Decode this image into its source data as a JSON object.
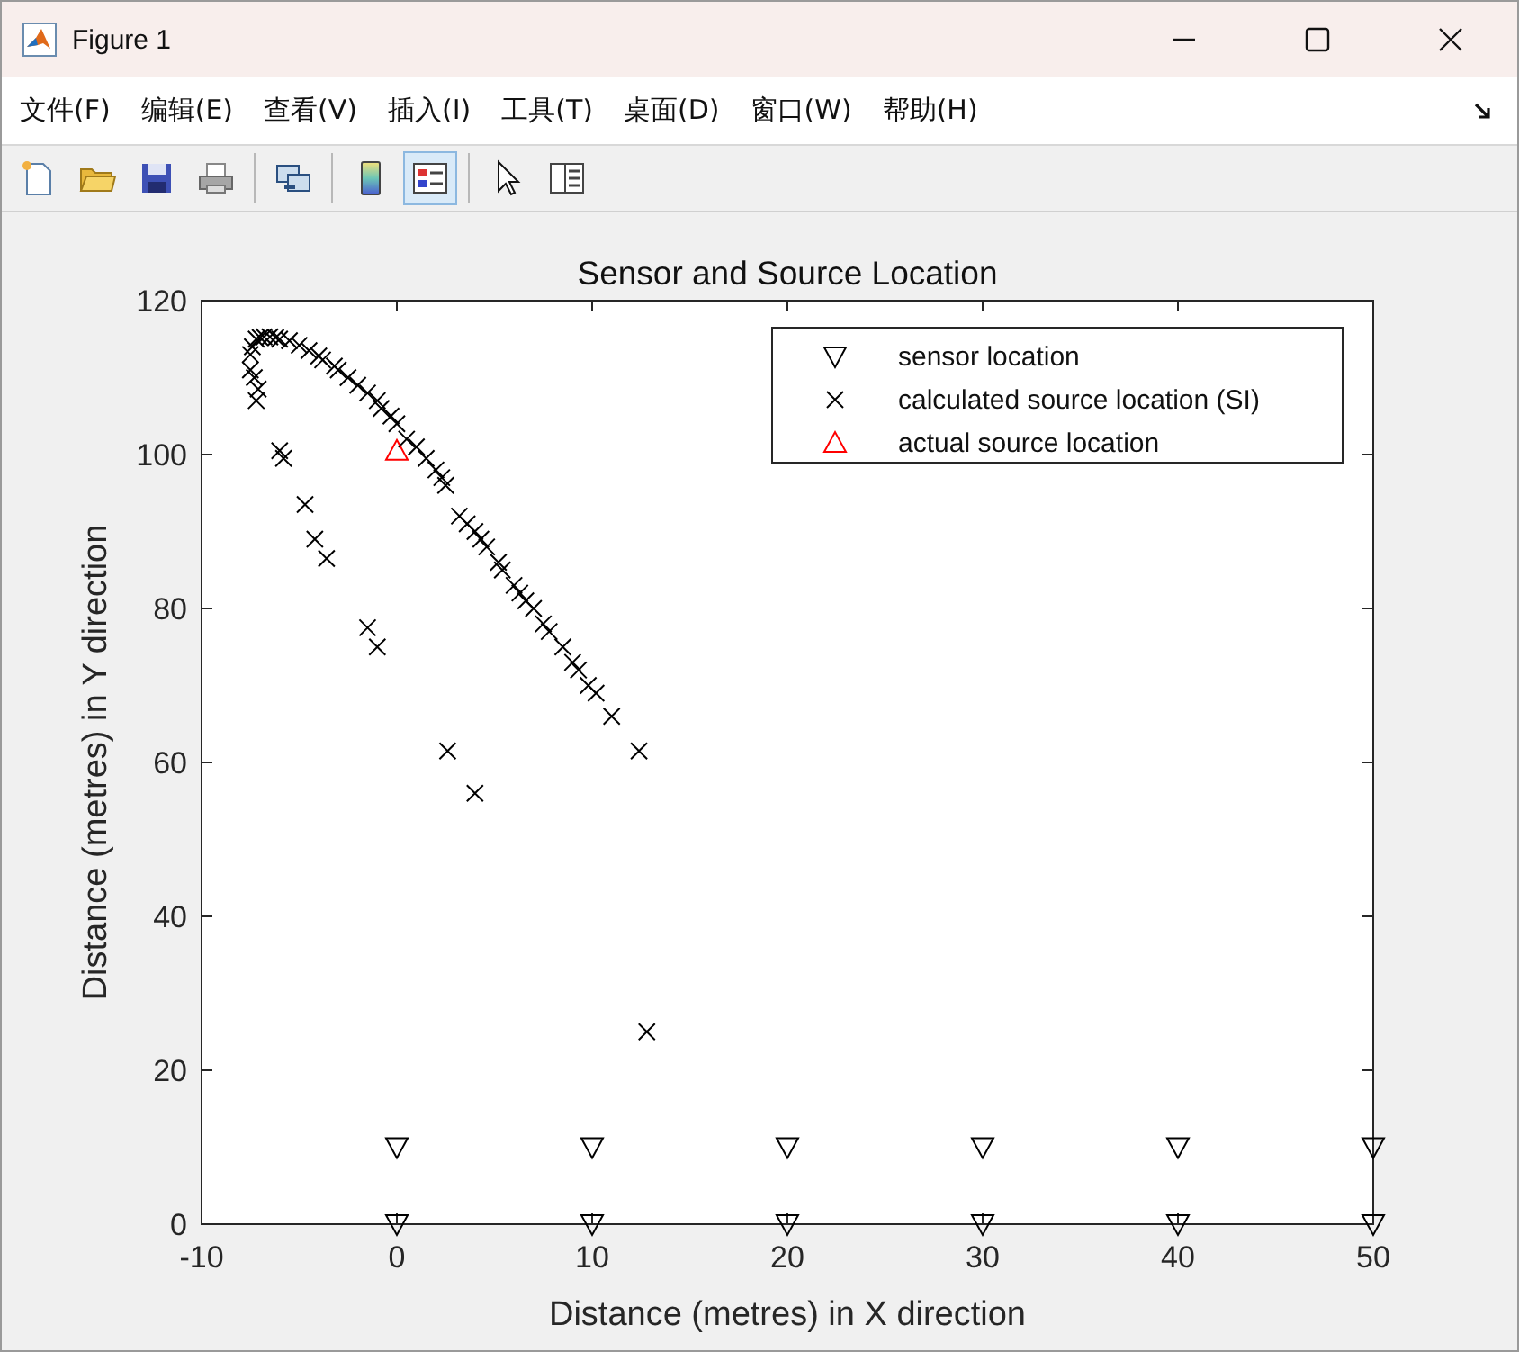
{
  "window": {
    "title": "Figure 1"
  },
  "menu": [
    "文件(F)",
    "编辑(E)",
    "查看(V)",
    "插入(I)",
    "工具(T)",
    "桌面(D)",
    "窗口(W)",
    "帮助(H)"
  ],
  "toolbar": [
    {
      "kind": "new",
      "selected": false
    },
    {
      "kind": "open",
      "selected": false
    },
    {
      "kind": "save",
      "selected": false
    },
    {
      "kind": "print",
      "selected": false
    },
    {
      "kind": "link",
      "selected": false
    },
    {
      "kind": "colorbar",
      "selected": false
    },
    {
      "kind": "legend",
      "selected": true
    },
    {
      "kind": "pointer",
      "selected": false
    },
    {
      "kind": "inspector",
      "selected": false
    }
  ],
  "figure": {
    "chart_data": {
      "type": "scatter",
      "title": "Sensor and Source Location",
      "xlabel": "Distance (metres) in X direction",
      "ylabel": "Distance (metres) in Y direction",
      "legend": true,
      "xlim": [
        -10,
        50
      ],
      "ylim": [
        0,
        120
      ],
      "xticks": [
        {
          "value": -10,
          "label": "-10"
        },
        {
          "value": 0,
          "label": "0"
        },
        {
          "value": 10,
          "label": "10"
        },
        {
          "value": 20,
          "label": "20"
        },
        {
          "value": 30,
          "label": "30"
        },
        {
          "value": 40,
          "label": "40"
        },
        {
          "value": 50,
          "label": "50"
        }
      ],
      "yticks": [
        {
          "value": 0,
          "label": "0"
        },
        {
          "value": 20,
          "label": "20"
        },
        {
          "value": 40,
          "label": "40"
        },
        {
          "value": 60,
          "label": "60"
        },
        {
          "value": 80,
          "label": "80"
        },
        {
          "value": 100,
          "label": "100"
        },
        {
          "value": 120,
          "label": "120"
        }
      ],
      "series": [
        {
          "name": "sensor location",
          "color": "#000000",
          "marker": "triangle-down",
          "x": [
            0,
            10,
            20,
            30,
            40,
            50,
            0,
            10,
            20,
            30,
            40,
            50
          ],
          "values": [
            0,
            0,
            0,
            0,
            0,
            0,
            10,
            10,
            10,
            10,
            10,
            10
          ]
        },
        {
          "name": "calculated source location (SI)",
          "color": "#000000",
          "marker": "cross",
          "x": [
            -7.5,
            -7.4,
            -7.2,
            -7,
            -6.8,
            -6.5,
            -6.2,
            -6,
            -5.5,
            -5,
            -4.5,
            -4,
            -3.8,
            -3.2,
            -3,
            -2.5,
            -2,
            -1.5,
            -1,
            -0.8,
            -0.3,
            0,
            0.5,
            1,
            1.5,
            2,
            2.3,
            2.5,
            3.2,
            3.6,
            4,
            4.3,
            4.6,
            5.2,
            5.4,
            6,
            6.3,
            6.6,
            7,
            7.5,
            7.8,
            8.5,
            9,
            9.3,
            9.8,
            10.2,
            11,
            12.4,
            -7.5,
            -7.3,
            -7.1,
            -7.2,
            -6,
            -5.8,
            -4.7,
            -4.2,
            -3.6,
            -1.5,
            -1,
            2.6,
            4,
            12.8
          ],
          "values": [
            113,
            114,
            115,
            115.2,
            115.3,
            115.3,
            115.2,
            115,
            114.8,
            114.2,
            113.5,
            112.8,
            112.3,
            111.5,
            111,
            110,
            109,
            108,
            107,
            106,
            105,
            104,
            102,
            101,
            99.5,
            98,
            97,
            96,
            92,
            91,
            90,
            89,
            88,
            86,
            85,
            83,
            82,
            81,
            80,
            78,
            77,
            75,
            73,
            72,
            70,
            69,
            66,
            61.5,
            111,
            110,
            108.5,
            107,
            100.5,
            99.5,
            93.5,
            89,
            86.5,
            77.5,
            75,
            61.5,
            56,
            25
          ]
        },
        {
          "name": "actual source location",
          "color": "#ff0000",
          "marker": "triangle-up",
          "x": [
            0
          ],
          "values": [
            100.5
          ]
        }
      ]
    }
  }
}
